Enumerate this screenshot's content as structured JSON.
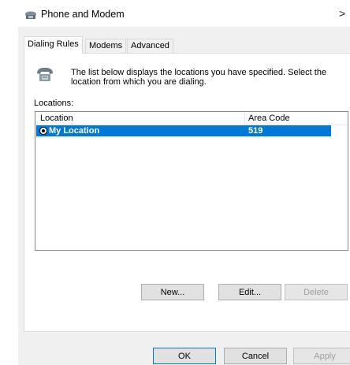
{
  "window": {
    "title": "Phone and Modem",
    "close_glyph": ">"
  },
  "tabs": [
    {
      "label": "Dialing Rules",
      "active": true
    },
    {
      "label": "Modems",
      "active": false
    },
    {
      "label": "Advanced",
      "active": false
    }
  ],
  "dialing_rules": {
    "description": "The list below displays the locations you have specified. Select the location from which you are dialing.",
    "locations_label": "Locations:",
    "columns": {
      "location": "Location",
      "area_code": "Area Code"
    },
    "rows": [
      {
        "location": "My Location",
        "area_code": "519",
        "selected": true
      }
    ],
    "buttons": {
      "new": "New...",
      "edit": "Edit...",
      "delete": "Delete"
    }
  },
  "footer": {
    "ok": "OK",
    "cancel": "Cancel",
    "apply": "Apply"
  },
  "colors": {
    "selection": "#0078d7",
    "dialog_bg": "#f0f0f0"
  },
  "icons": {
    "title": "phone-modem-icon",
    "description": "telephone-icon"
  }
}
